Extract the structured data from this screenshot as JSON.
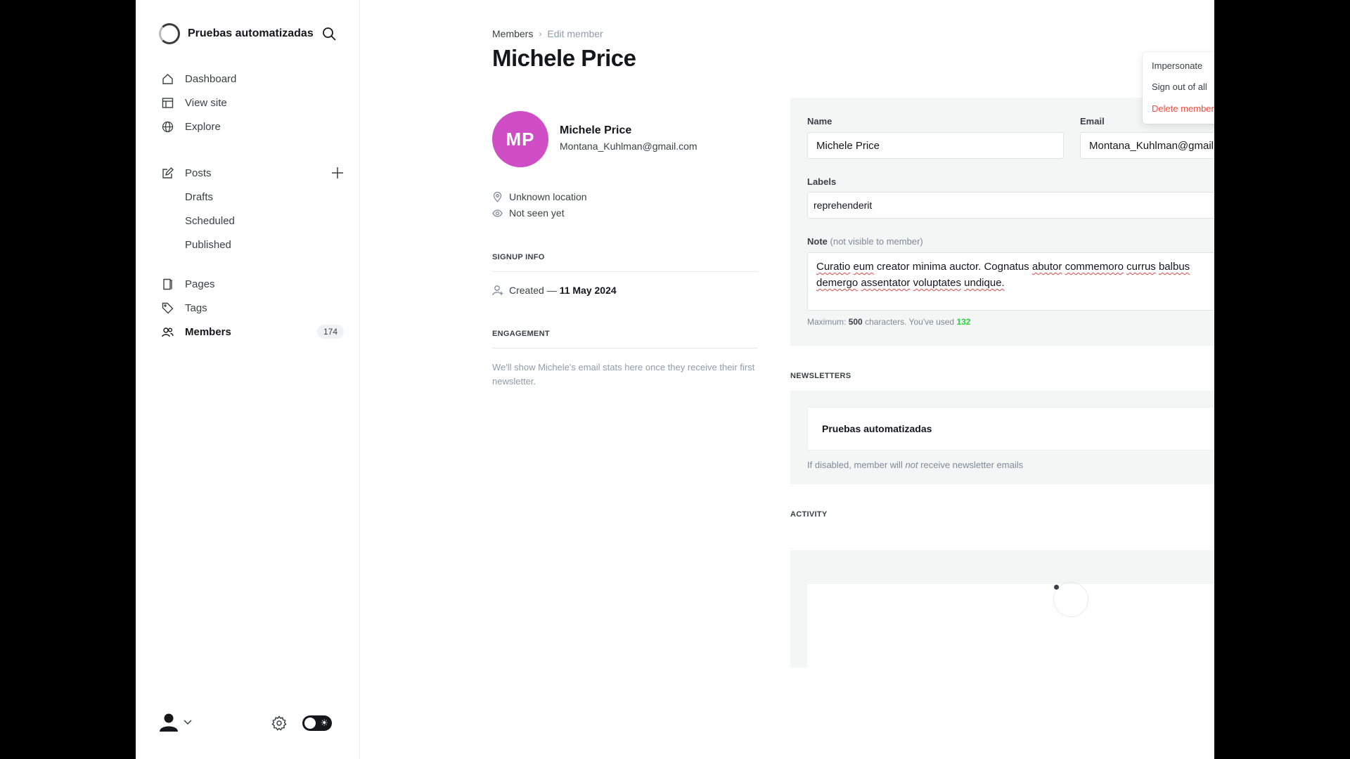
{
  "sidebar": {
    "site_name": "Pruebas automatizadas",
    "primary_nav": [
      {
        "label": "Dashboard",
        "icon": "home-icon"
      },
      {
        "label": "View site",
        "icon": "layout-icon"
      },
      {
        "label": "Explore",
        "icon": "globe-icon"
      }
    ],
    "posts": {
      "label": "Posts",
      "sub": [
        "Drafts",
        "Scheduled",
        "Published"
      ]
    },
    "secondary_nav": [
      {
        "label": "Pages",
        "icon": "page-icon"
      },
      {
        "label": "Tags",
        "icon": "tag-icon"
      },
      {
        "label": "Members",
        "icon": "members-icon",
        "count": "174",
        "active": true
      }
    ]
  },
  "breadcrumb": {
    "parent": "Members",
    "separator": "›",
    "current": "Edit member"
  },
  "page_title": "Michele Price",
  "member": {
    "initials": "MP",
    "avatar_color": "#cf4dc5",
    "name": "Michele Price",
    "email": "Montana_Kuhlman@gmail.com",
    "location": "Unknown location",
    "last_seen": "Not seen yet"
  },
  "signup_info": {
    "heading": "SIGNUP INFO",
    "created_label": "Created —",
    "created_date": "11 May 2024"
  },
  "engagement": {
    "heading": "ENGAGEMENT",
    "text": "We'll show Michele's email stats here once they receive their first newsletter."
  },
  "form": {
    "name_label": "Name",
    "name_value": "Michele Price",
    "email_label": "Email",
    "email_value": "Montana_Kuhlman@gmail.com",
    "labels_label": "Labels",
    "labels_value": "reprehenderit",
    "note_label": "Note",
    "note_sub": "(not visible to member)",
    "note_line1_words": [
      "Curatio",
      "eum",
      "creator",
      "minima",
      "auctor.",
      "Cognatus",
      "abutor",
      "commemoro",
      "currus",
      "balbus"
    ],
    "note_line2_words": [
      "demergo",
      "assentator",
      "voluptates",
      "undique."
    ],
    "note_hint_prefix": "Maximum:",
    "note_max": "500",
    "note_hint_mid": "characters. You've used",
    "note_used": "132"
  },
  "newsletters": {
    "heading": "NEWSLETTERS",
    "items": [
      "Pruebas automatizadas"
    ],
    "hint_before": "If disabled, member will",
    "hint_em": "not",
    "hint_after": "receive newsletter emails"
  },
  "activity": {
    "heading": "ACTIVITY"
  },
  "dropdown": {
    "items": [
      "Impersonate",
      "Sign out of all",
      "Delete member"
    ]
  },
  "colors": {
    "accent_green": "#30cf43",
    "danger": "#f04b3c",
    "panel_bg": "#f4f5f5"
  }
}
